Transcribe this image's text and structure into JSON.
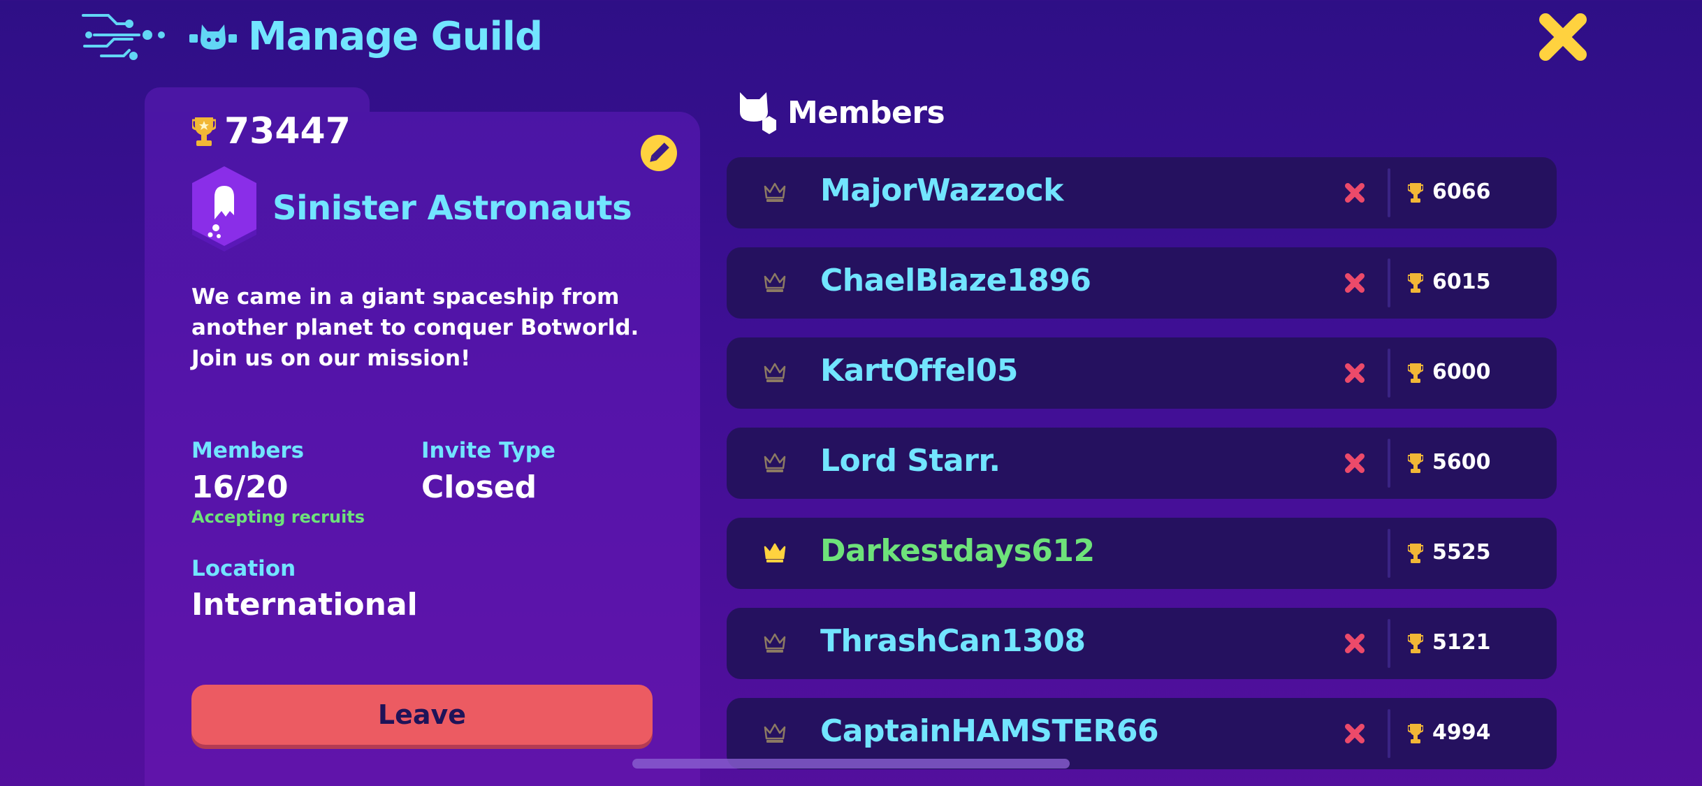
{
  "header": {
    "title": "Manage Guild",
    "back_icon": "back-lines-icon",
    "guild_icon": "cat-guild-icon",
    "close_icon": "close-x-icon",
    "accent_color": "#72e5ff",
    "close_color": "#ffd23f"
  },
  "guild": {
    "trophies": "73447",
    "name": "Sinister Astronauts",
    "description": "We came in a giant spaceship from another planet to conquer Botworld. Join us on our mission!",
    "members_label": "Members",
    "members_value": "16/20",
    "members_status": "Accepting recruits",
    "invite_type_label": "Invite Type",
    "invite_type_value": "Closed",
    "location_label": "Location",
    "location_value": "International",
    "leave_label": "Leave",
    "badge_color": "#8a2ee8"
  },
  "members": {
    "title": "Members",
    "list": [
      {
        "name": "MajorWazzock",
        "trophies": "6066",
        "leader": false,
        "kickable": true
      },
      {
        "name": "ChaelBlaze1896",
        "trophies": "6015",
        "leader": false,
        "kickable": true
      },
      {
        "name": "KartOffel05",
        "trophies": "6000",
        "leader": false,
        "kickable": true
      },
      {
        "name": "Lord Starr.",
        "trophies": "5600",
        "leader": false,
        "kickable": true
      },
      {
        "name": "Darkestdays612",
        "trophies": "5525",
        "leader": true,
        "kickable": false
      },
      {
        "name": "ThrashCan1308",
        "trophies": "5121",
        "leader": false,
        "kickable": true
      },
      {
        "name": "CaptainHAMSTER66",
        "trophies": "4994",
        "leader": false,
        "kickable": true
      }
    ]
  },
  "colors": {
    "leader_name": "#6ee27a",
    "kick": "#ec4a6a",
    "trophy": "#f2b736",
    "leave_button": "#ec5b62"
  }
}
